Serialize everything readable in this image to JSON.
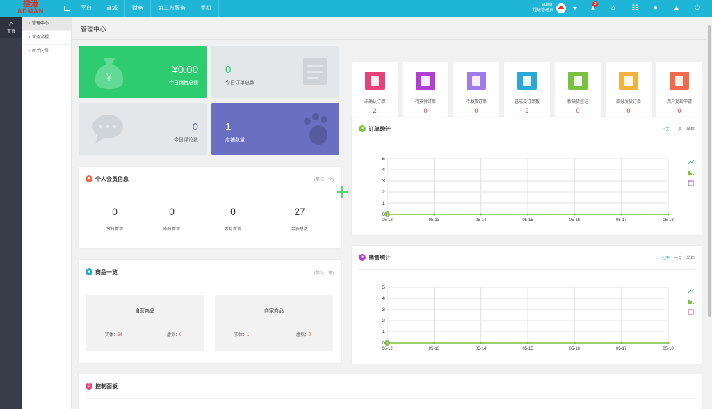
{
  "brand": {
    "name_cn": "搜港",
    "name_en": "ADMAN"
  },
  "topnav": [
    "平台",
    "商城",
    "财务",
    "第三方服务",
    "手机"
  ],
  "user": {
    "name": "admin",
    "role": "超级管理员",
    "notifications": "3"
  },
  "sidebar": {
    "home": "首页"
  },
  "subnav": [
    "管理中心",
    "业务流程",
    "新手向导"
  ],
  "page_title": "管理中心",
  "stats": [
    {
      "value": "¥0.00",
      "label": "今日销售总额"
    },
    {
      "value": "0",
      "label": "今日订单总数"
    },
    {
      "value": "0",
      "label": "今日评论数"
    },
    {
      "value": "1",
      "label": "店铺数量"
    }
  ],
  "member": {
    "title": "个人会员信息",
    "unit": "(单位：个)",
    "items": [
      {
        "value": "0",
        "label": "今日新增"
      },
      {
        "value": "0",
        "label": "昨日新增"
      },
      {
        "value": "0",
        "label": "本月新增"
      },
      {
        "value": "27",
        "label": "会员总数"
      }
    ]
  },
  "goods": {
    "title": "商品一览",
    "unit": "(单位：件)",
    "boxes": [
      {
        "title": "自营商品",
        "real_label": "实体：",
        "real": "54",
        "virtual_label": "虚拟：",
        "virtual": "0"
      },
      {
        "title": "商家商品",
        "real_label": "实体：",
        "real": "1",
        "virtual_label": "虚拟：",
        "virtual": "0"
      }
    ]
  },
  "quick": [
    {
      "label": "未确认订单",
      "value": "2",
      "color": "#e9407a"
    },
    {
      "label": "待支付订单",
      "value": "0",
      "color": "#b23ed4"
    },
    {
      "label": "待发货订单",
      "value": "0",
      "color": "#a07ce8"
    },
    {
      "label": "已成交订单数",
      "value": "2",
      "color": "#2aa8d8"
    },
    {
      "label": "新缺货登记",
      "value": "0",
      "color": "#7ac142"
    },
    {
      "label": "部分发货订单",
      "value": "0",
      "color": "#f2b33d"
    },
    {
      "label": "用户提现申请",
      "value": "0",
      "color": "#f26a4b"
    }
  ],
  "orders_chart": {
    "title": "订单统计",
    "tabs": [
      "七天",
      "一月",
      "半年"
    ]
  },
  "sales_chart": {
    "title": "销售统计",
    "tabs": [
      "七天",
      "一月",
      "半年"
    ]
  },
  "control": {
    "title": "控制面板"
  },
  "chart_data": [
    {
      "type": "line",
      "x": [
        "05-12",
        "05-13",
        "05-14",
        "05-15",
        "05-16",
        "05-17",
        "05-18"
      ],
      "values": [
        0,
        0,
        0,
        0,
        0,
        0,
        0
      ],
      "ylim": [
        0,
        5
      ],
      "yticks": [
        0,
        1,
        2,
        3,
        4,
        5
      ],
      "color": "#7ac142",
      "marker_label": "0"
    },
    {
      "type": "line",
      "x": [
        "05-12",
        "05-13",
        "05-14",
        "05-15",
        "05-16",
        "05-17",
        "05-18"
      ],
      "values": [
        0,
        0,
        0,
        0,
        0,
        0,
        0
      ],
      "ylim": [
        0,
        5
      ],
      "yticks": [
        0,
        1,
        2,
        3,
        4,
        5
      ],
      "color": "#7ac142",
      "marker_label": "0"
    }
  ]
}
